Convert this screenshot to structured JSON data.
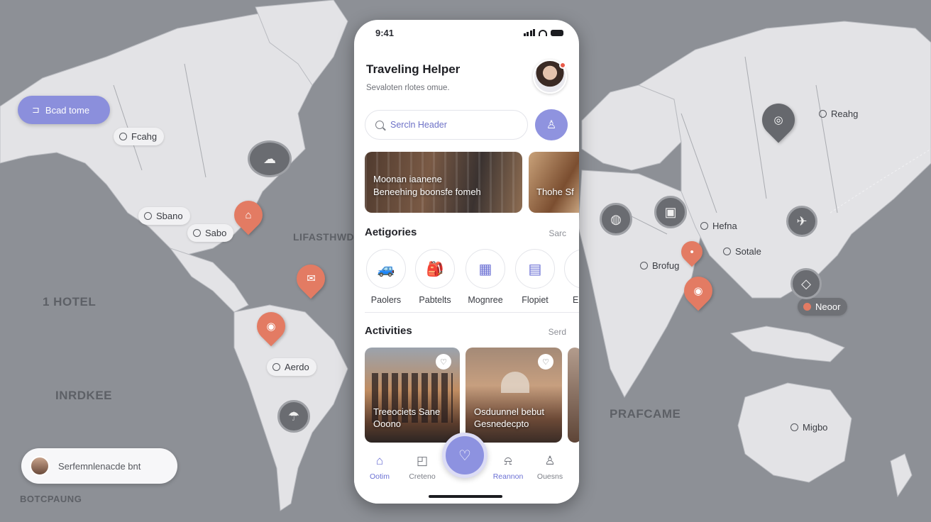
{
  "map": {
    "button_label": "Bcad tome",
    "search_label": "Serfemnlenacde bnt",
    "labels": [
      "Fcahg",
      "Sbano",
      "Sabo",
      "Aerdo",
      "Reahg",
      "Hefna",
      "Sotale",
      "Brofug",
      "Neoor",
      "Migbo"
    ],
    "regions": [
      "LIFASTHWD",
      "1 HOTEL",
      "INRDKEE",
      "PRAFCAME",
      "BOTCPAUNG"
    ]
  },
  "phone": {
    "status": {
      "time": "9:41"
    },
    "header": {
      "title": "Traveling Helper",
      "subtitle": "Sevaloten rlotes omue."
    },
    "search": {
      "placeholder": "Sercln Header"
    },
    "featured": [
      {
        "line1": "Moonan iaanene",
        "line2": "Beneehing boonsfe fomeh"
      },
      {
        "line1": "Thohe Sf",
        "line2": ""
      }
    ],
    "categories": {
      "title": "Aetigories",
      "link": "Sarc",
      "items": [
        {
          "label": "Paolers",
          "icon": "car-icon"
        },
        {
          "label": "Pabtelts",
          "icon": "backpack-icon"
        },
        {
          "label": "Mognree",
          "icon": "building-icon"
        },
        {
          "label": "Flopiet",
          "icon": "calendar-icon"
        },
        {
          "label": "E",
          "icon": "more-icon"
        }
      ]
    },
    "activities": {
      "title": "Activities",
      "link": "Serd",
      "items": [
        {
          "line1": "Treeociets Sane",
          "line2": "Ooono"
        },
        {
          "line1": "Osduunnel bebut",
          "line2": "Gesnedecpto"
        }
      ]
    },
    "tabs": [
      {
        "label": "Ootim",
        "icon": "home-icon"
      },
      {
        "label": "Creteno",
        "icon": "calendar-icon"
      },
      {
        "label": "Reannon",
        "icon": "bell-icon"
      },
      {
        "label": "Ouesns",
        "icon": "user-icon"
      }
    ]
  },
  "colors": {
    "accent": "#8d92e0",
    "pin": "#e37b63",
    "map_background": "#8d9096",
    "land": "#e6e6e8"
  }
}
